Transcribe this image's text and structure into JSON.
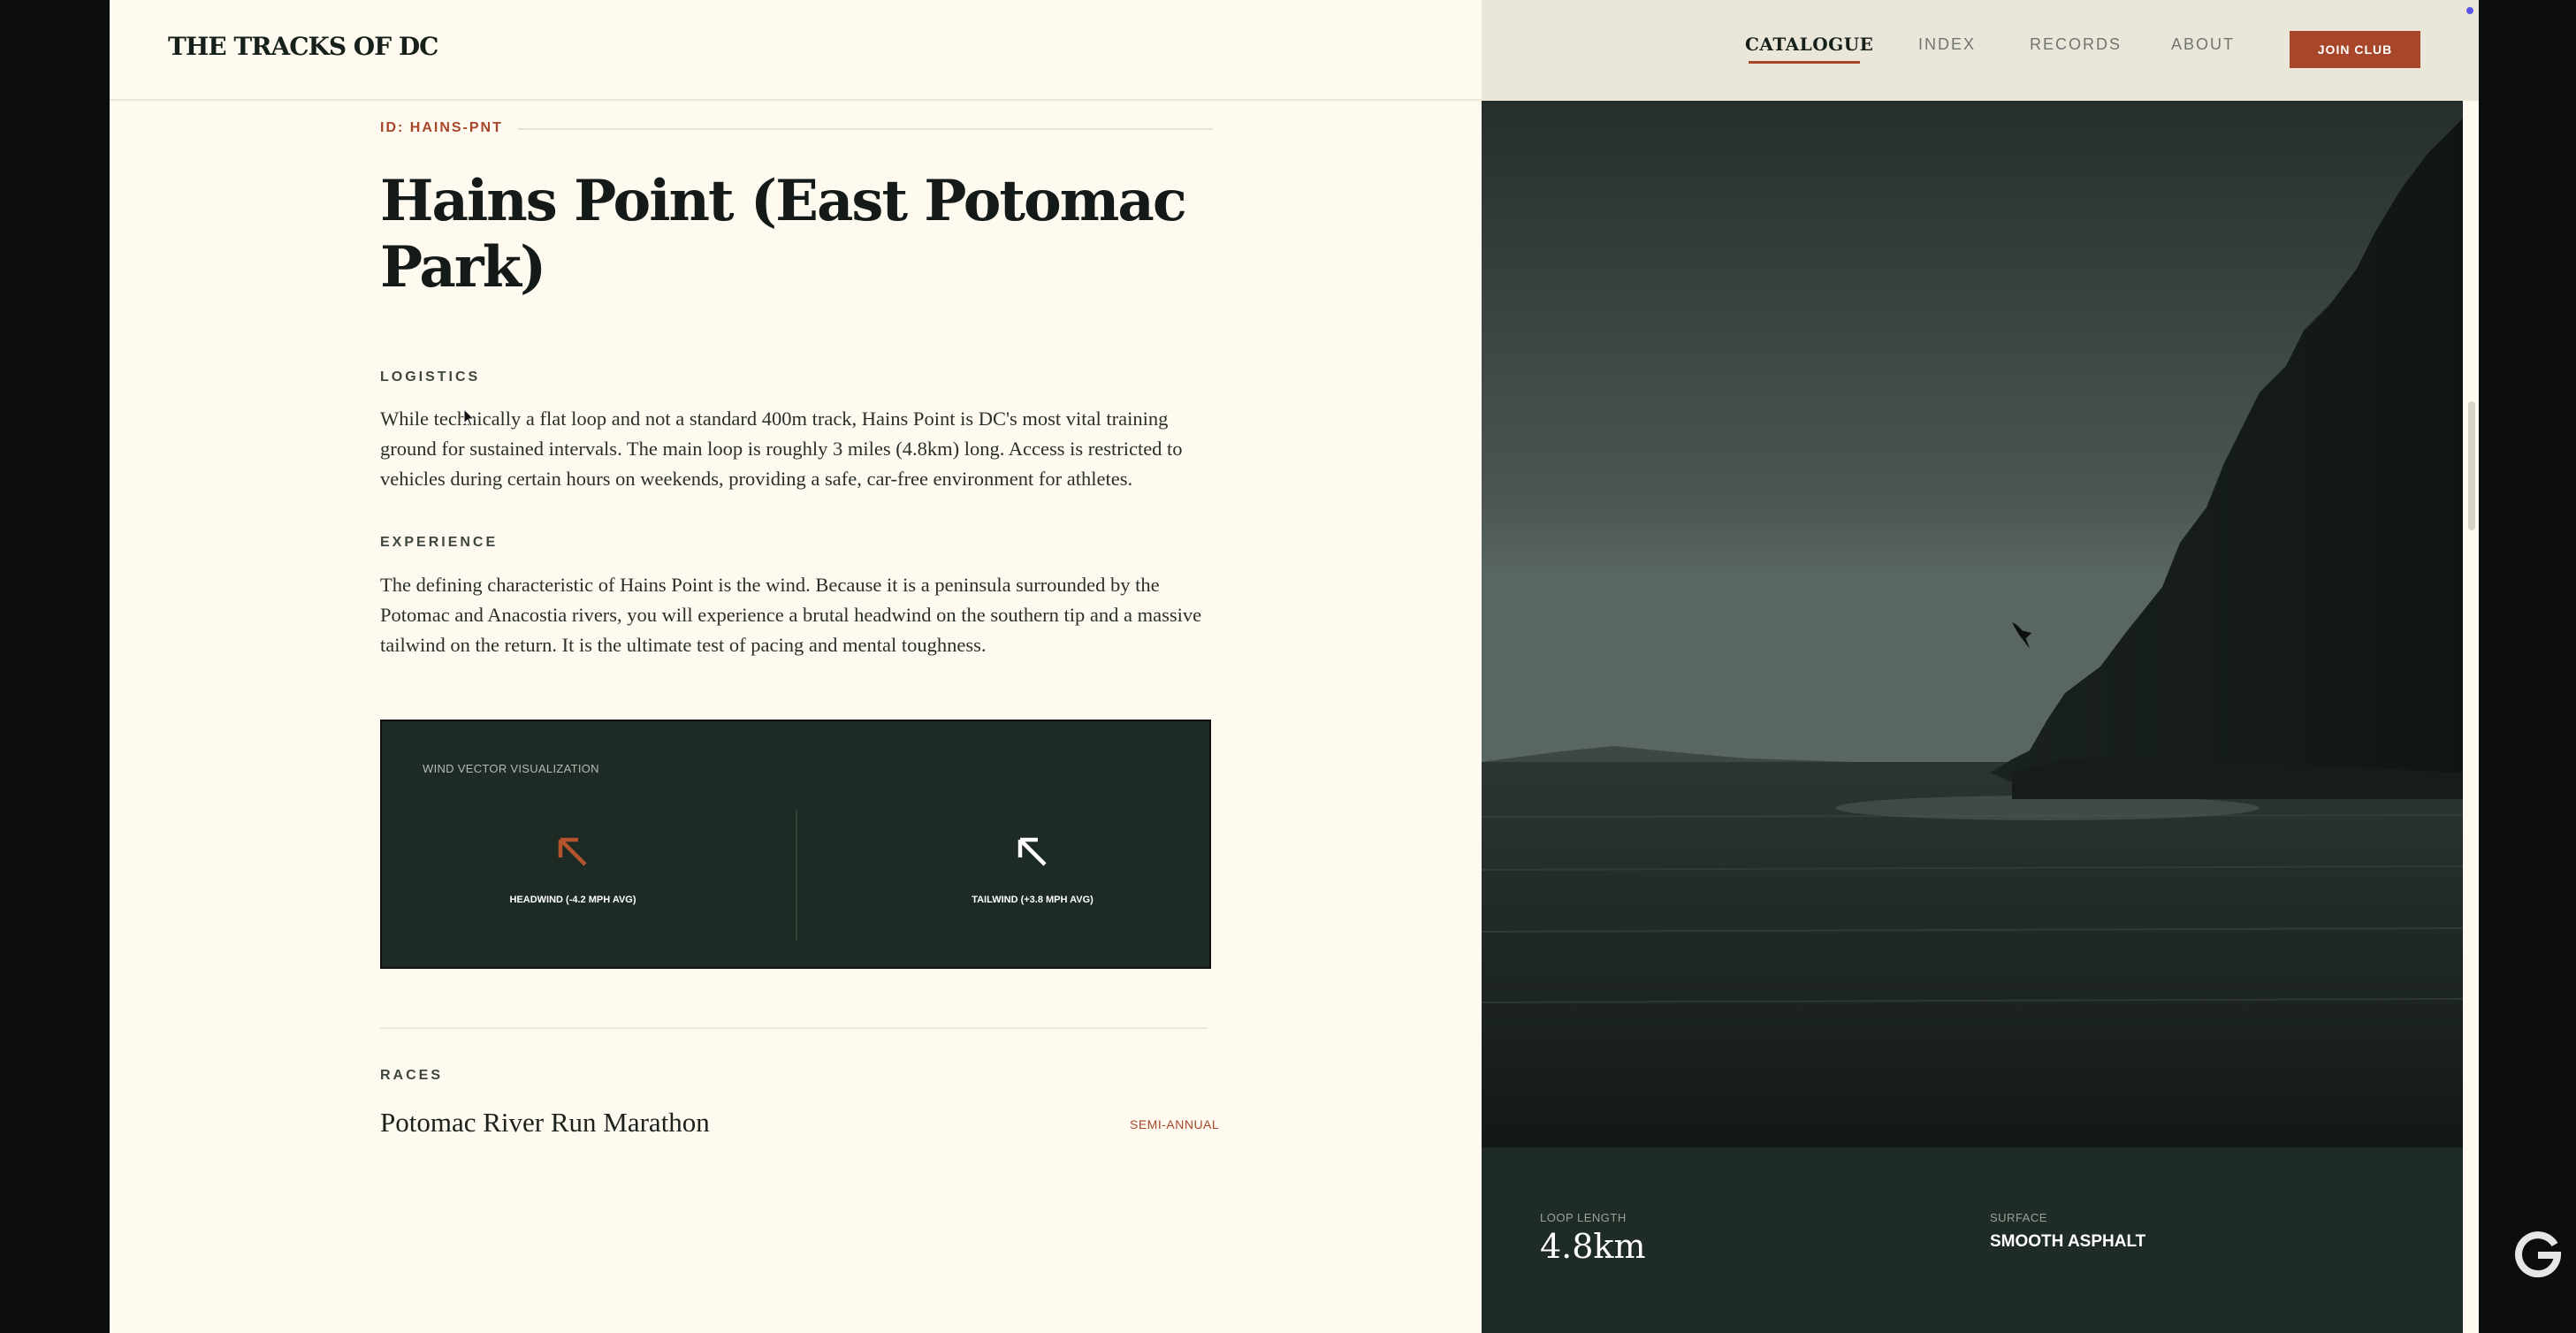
{
  "header": {
    "logo": "THE TRACKS OF DC",
    "nav": [
      {
        "label": "CATALOGUE",
        "active": true
      },
      {
        "label": "INDEX"
      },
      {
        "label": "RECORDS"
      },
      {
        "label": "ABOUT"
      }
    ],
    "join_button": "JOIN CLUB"
  },
  "content": {
    "id": "ID: HAINS-PNT",
    "title": "Hains Point (East Potomac Park)",
    "logistics_label": "LOGISTICS",
    "logistics_text": "While technically a flat loop and not a standard 400m track, Hains Point is DC's most vital training ground for sustained intervals. The main loop is roughly 3 miles (4.8km) long. Access is restricted to vehicles during certain hours on weekends, providing a safe, car-free environment for athletes.",
    "experience_label": "EXPERIENCE",
    "experience_text": "The defining characteristic of Hains Point is the wind. Because it is a peninsula surrounded by the Potomac and Anacostia rivers, you will experience a brutal headwind on the southern tip and a massive tailwind on the return. It is the ultimate test of pacing and mental toughness."
  },
  "wind_viz": {
    "label": "WIND VECTOR VISUALIZATION",
    "headwind_caption": "HEADWIND (-4.2 MPH AVG)",
    "tailwind_caption": "TAILWIND (+3.8 MPH AVG)",
    "headwind_color": "#b5532c",
    "tailwind_color": "#ffffff"
  },
  "races": {
    "label": "RACES",
    "items": [
      {
        "name": "Potomac River Run Marathon",
        "frequency": "SEMI-ANNUAL"
      }
    ]
  },
  "stats": {
    "loop_length_label": "LOOP LENGTH",
    "loop_length_value": "4.8km",
    "surface_label": "SURFACE",
    "surface_value": "SMOOTH ASPHALT"
  },
  "colors": {
    "accent": "#a8462a",
    "page_bg": "#fefaf0",
    "dark_green": "#1f2b25"
  },
  "icons": [
    "arrow-up-left-icon",
    "cursor-icon",
    "google-g-icon"
  ]
}
